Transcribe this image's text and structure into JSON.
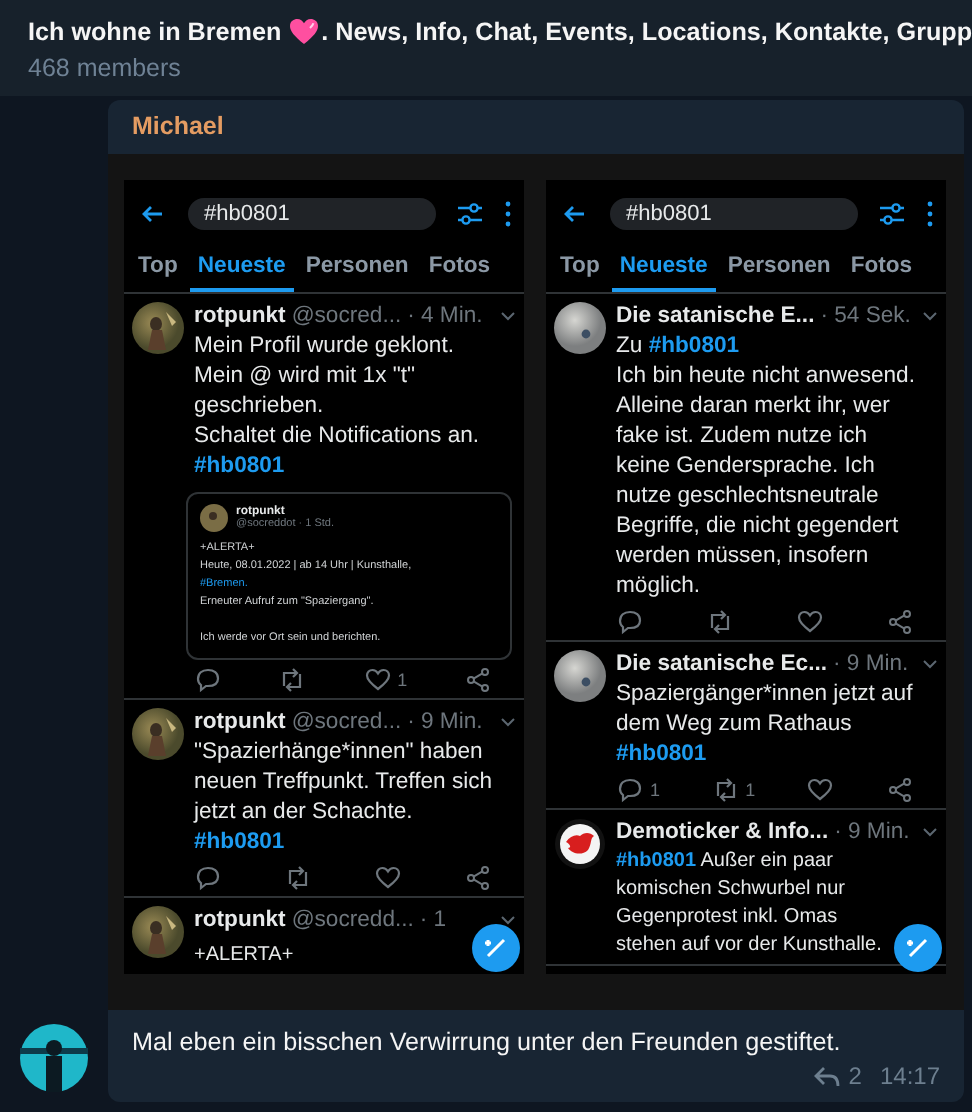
{
  "header": {
    "title_before_emoji": "Ich wohne in Bremen",
    "title_after_emoji": ". News, Info, Chat, Events, Locations, Kontakte, Grupp",
    "members": "468 members"
  },
  "message": {
    "sender": "Michael",
    "caption": "Mal eben ein bisschen Verwirrung unter den Freunden gestiftet.",
    "replies": "2",
    "time": "14:17"
  },
  "screenshots": [
    {
      "search": "#hb0801",
      "tabs": [
        {
          "label": "Top",
          "selected": false
        },
        {
          "label": "Neueste",
          "selected": true
        },
        {
          "label": "Personen",
          "selected": false
        },
        {
          "label": "Fotos",
          "selected": false
        }
      ],
      "tweets": [
        {
          "kind": "figure",
          "name": "rotpunkt",
          "handle": "@socred...",
          "time": "· 4 Min.",
          "text": "Mein Profil wurde geklont.\nMein @ wird mit 1x \"t\"\ngeschrieben.\nSchaltet die Notifications an.\n**#hb0801**",
          "quote": {
            "name": "rotpunkt",
            "handle": "@socreddot · 1 Std.",
            "text": "+ALERTA+\nHeute, 08.01.2022 | ab 14 Uhr | Kunsthalle,\n**#Bremen.**\nErneuter Aufruf zum \"Spaziergang\".\n\nIch werde vor Ort sein und berichten."
          },
          "actions": [
            {
              "kind": "reply"
            },
            {
              "kind": "retweet"
            },
            {
              "kind": "like",
              "count": "1"
            },
            {
              "kind": "share"
            }
          ]
        },
        {
          "kind": "figure",
          "name": "rotpunkt",
          "handle": "@socred...",
          "time": "· 9 Min.",
          "text": "\"Spazierhänge*innen\" haben\nneuen Treffpunkt. Treffen sich\njetzt an der Schachte.\n**#hb0801**",
          "actions": [
            {
              "kind": "reply"
            },
            {
              "kind": "retweet"
            },
            {
              "kind": "like"
            },
            {
              "kind": "share"
            }
          ]
        },
        {
          "kind": "figure",
          "name": "rotpunkt",
          "handle": "@socredd...",
          "time": "· 1",
          "text": "+ALERTA+"
        }
      ]
    },
    {
      "search": "#hb0801",
      "tabs": [
        {
          "label": "Top",
          "selected": false
        },
        {
          "label": "Neueste",
          "selected": true
        },
        {
          "label": "Personen",
          "selected": false
        },
        {
          "label": "Fotos",
          "selected": false
        }
      ],
      "tweets": [
        {
          "kind": "sphere",
          "name": "Die satanische E...",
          "time": "· 54 Sek.",
          "text": "Zu **#hb0801**\nIch bin heute nicht anwesend.\nAlleine daran merkt ihr, wer\nfake ist. Zudem nutze ich\nkeine Gendersprache. Ich\nnutze geschlechtsneutrale\nBegriffe, die nicht gegendert\nwerden müssen, insofern\nmöglich.",
          "actions": [
            {
              "kind": "reply"
            },
            {
              "kind": "retweet"
            },
            {
              "kind": "like"
            },
            {
              "kind": "share"
            }
          ]
        },
        {
          "kind": "sphere",
          "name": "Die satanische Ec...",
          "time": "· 9 Min.",
          "text": "Spaziergänger*innen jetzt auf\ndem Weg zum Rathaus\n**#hb0801**",
          "actions": [
            {
              "kind": "reply",
              "count": "1"
            },
            {
              "kind": "retweet",
              "count": "1"
            },
            {
              "kind": "like"
            },
            {
              "kind": "share"
            }
          ]
        },
        {
          "kind": "logo",
          "name": "Demoticker & Info...",
          "time": "· 9 Min.",
          "text": "**#hb0801** Außer ein paar\nkomischen Schwurbel nur\nGegenprotest inkl. Omas\nstehen auf vor der Kunsthalle."
        }
      ]
    }
  ]
}
